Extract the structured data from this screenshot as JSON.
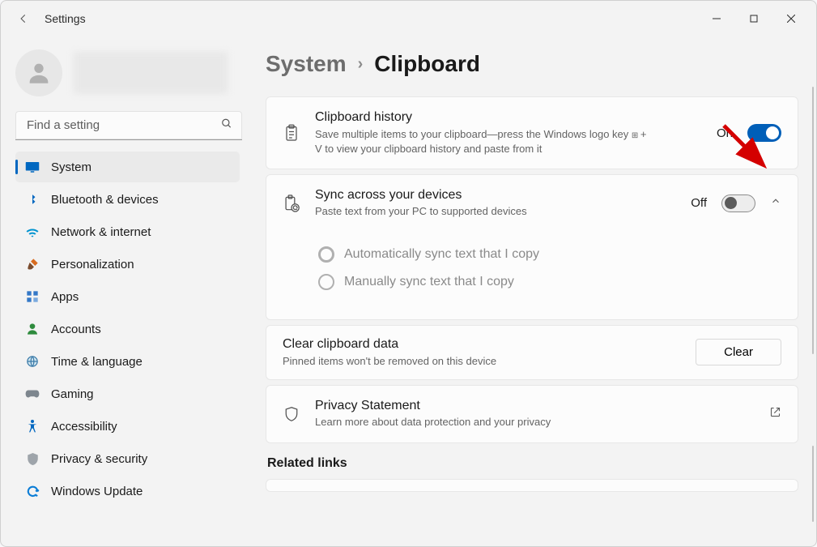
{
  "titlebar": {
    "app_title": "Settings"
  },
  "sidebar": {
    "search_placeholder": "Find a setting",
    "items": [
      {
        "label": "System",
        "icon": "display"
      },
      {
        "label": "Bluetooth & devices",
        "icon": "bluetooth"
      },
      {
        "label": "Network & internet",
        "icon": "wifi"
      },
      {
        "label": "Personalization",
        "icon": "brush"
      },
      {
        "label": "Apps",
        "icon": "apps"
      },
      {
        "label": "Accounts",
        "icon": "person"
      },
      {
        "label": "Time & language",
        "icon": "globe"
      },
      {
        "label": "Gaming",
        "icon": "gamepad"
      },
      {
        "label": "Accessibility",
        "icon": "a11y"
      },
      {
        "label": "Privacy & security",
        "icon": "shield"
      },
      {
        "label": "Windows Update",
        "icon": "update"
      }
    ],
    "selected_index": 0
  },
  "breadcrumb": {
    "prev": "System",
    "sep": "›",
    "current": "Clipboard"
  },
  "cards": {
    "history": {
      "title": "Clipboard history",
      "description_before_key": "Save multiple items to your clipboard—press the Windows logo key ",
      "description_after_key": " + V to view your clipboard history and paste from it",
      "state_label": "On",
      "state": true
    },
    "sync": {
      "title": "Sync across your devices",
      "description": "Paste text from your PC to supported devices",
      "state_label": "Off",
      "state": false,
      "options": [
        "Automatically sync text that I copy",
        "Manually sync text that I copy"
      ]
    },
    "clear": {
      "title": "Clear clipboard data",
      "description": "Pinned items won't be removed on this device",
      "button_label": "Clear"
    },
    "privacy": {
      "title": "Privacy Statement",
      "description": "Learn more about data protection and your privacy"
    }
  },
  "related_header": "Related links"
}
